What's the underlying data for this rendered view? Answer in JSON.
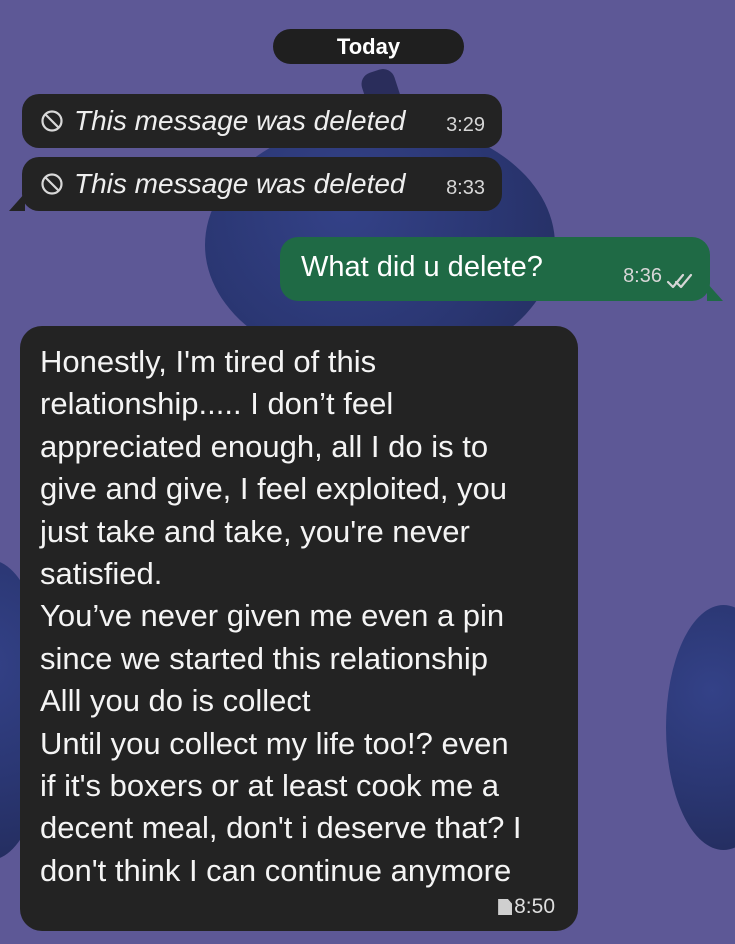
{
  "chat": {
    "date_label": "Today",
    "messages": [
      {
        "type": "deleted",
        "direction": "incoming",
        "text": "This message was deleted",
        "time": "3:29"
      },
      {
        "type": "deleted",
        "direction": "incoming",
        "text": "This message was deleted",
        "time": "8:33"
      },
      {
        "type": "text",
        "direction": "outgoing",
        "text": "What did u delete?",
        "time": "8:36"
      },
      {
        "type": "text",
        "direction": "incoming",
        "text": "Honestly,  I'm tired of this\nrelationship..... I don’t feel\nappreciated enough, all I do is to\ngive and give, I feel exploited, you\njust take and take, you're never\nsatisfied.\nYou’ve never given me even a pin\nsince we started this relationship\nAlll you do is collect\nUntil you collect my life too!? even\nif it's boxers or at least cook me a\ndecent meal, don't i deserve that? I\ndon't think I can continue anymore",
        "time": "8:50"
      }
    ]
  },
  "icons": {
    "deleted": "ban-icon",
    "read_receipt": "double-check-icon",
    "attachment": "document-icon"
  },
  "colors": {
    "background": "#5d5896",
    "incoming_bubble": "#232323",
    "outgoing_bubble": "#1f6a45",
    "date_chip": "#1f1f1f"
  }
}
